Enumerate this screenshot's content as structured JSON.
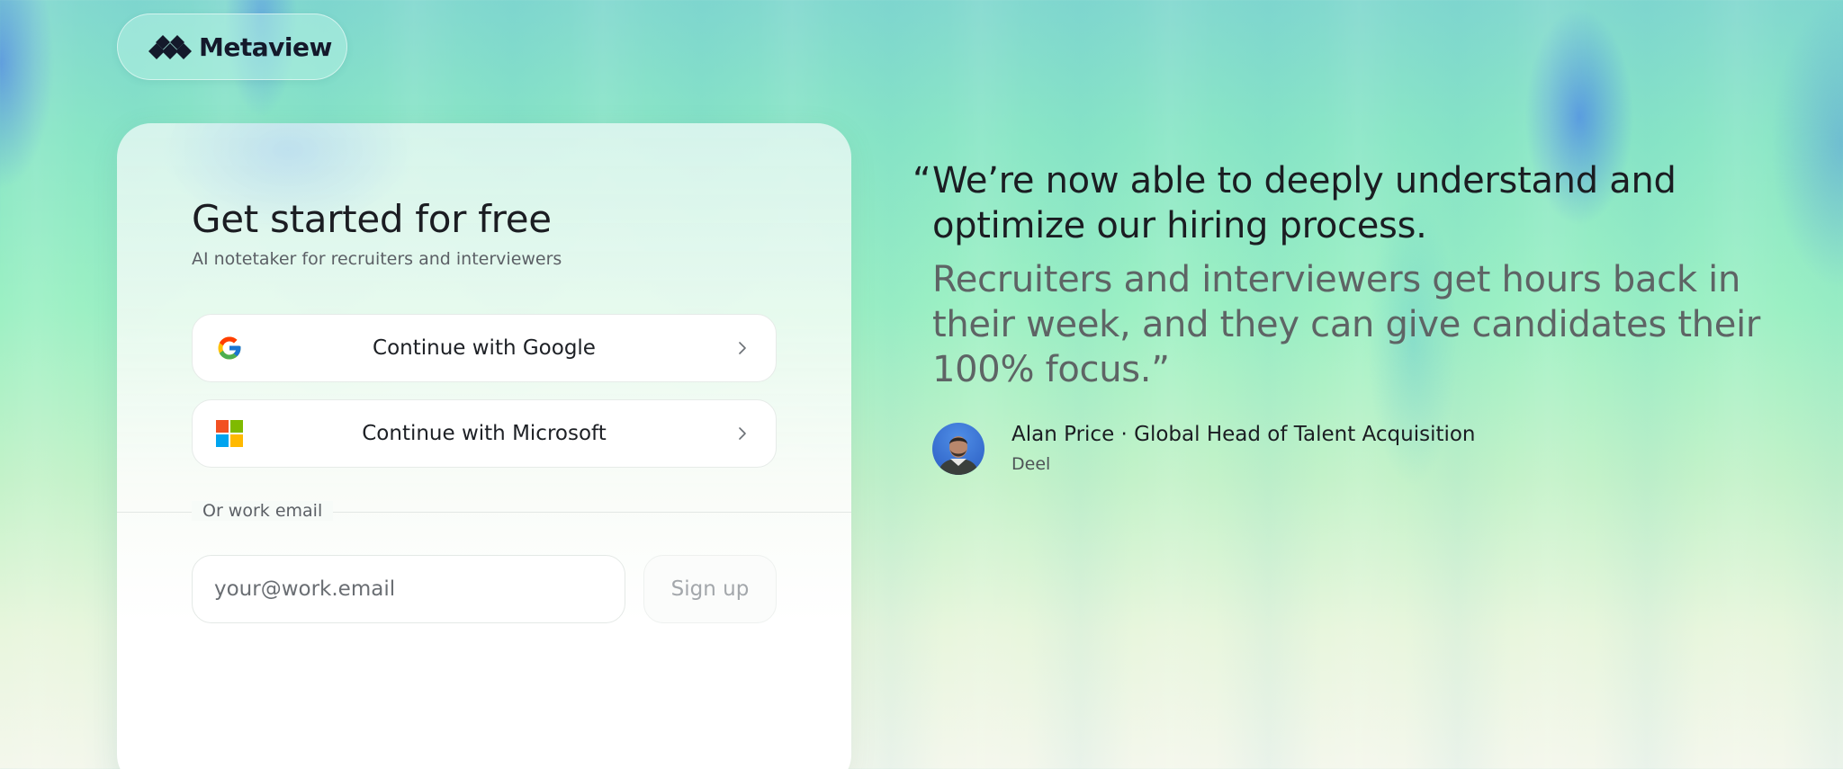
{
  "brand": {
    "name": "Metaview"
  },
  "signup_card": {
    "title": "Get started for free",
    "subtitle": "AI notetaker for recruiters and interviewers",
    "google_button_label": "Continue with Google",
    "microsoft_button_label": "Continue with Microsoft",
    "divider_label": "Or work email",
    "email_placeholder": "your@work.email",
    "email_value": "",
    "signup_button_label": "Sign up"
  },
  "testimonial": {
    "open_quote": "“",
    "quote_main": "We’re now able to deeply understand and optimize our hiring process.",
    "quote_sub": "Recruiters and interviewers get hours back in their week, and they can give candidates their 100% focus.”",
    "author_line": "Alan Price · Global Head of Talent Acquisition",
    "company": "Deel"
  },
  "icons": {
    "logo": "metaview-logo-icon",
    "google": "google-icon",
    "microsoft": "microsoft-icon",
    "chevron": "chevron-right-icon"
  },
  "colors": {
    "text_primary": "#1b1d22",
    "text_secondary": "#5e6465",
    "microsoft_red": "#f25022",
    "microsoft_green": "#7fba00",
    "microsoft_blue": "#00a4ef",
    "microsoft_yellow": "#ffb900"
  }
}
